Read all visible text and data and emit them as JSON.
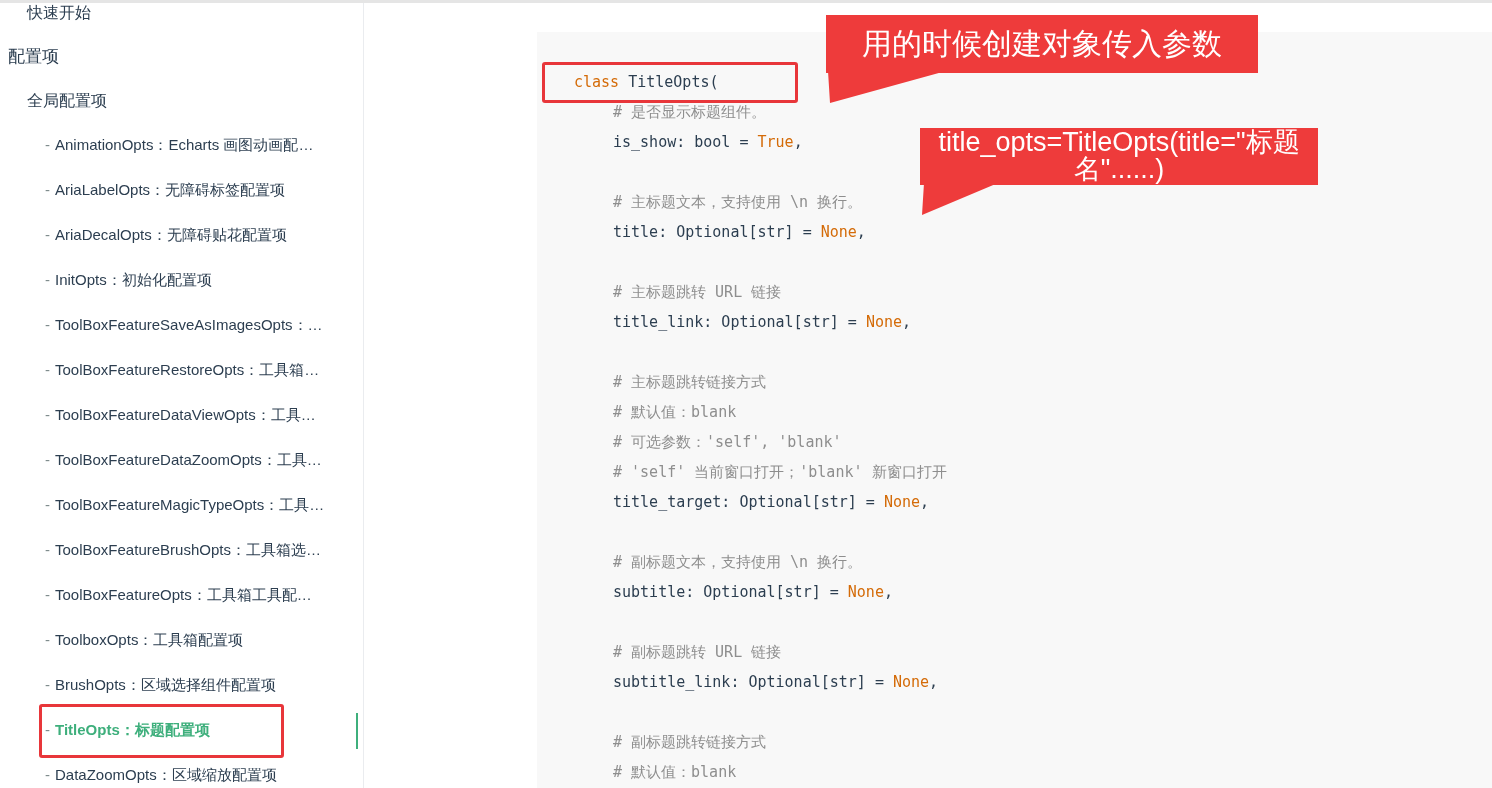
{
  "sidebar": {
    "items": [
      {
        "label": "快速开始",
        "kind": "page"
      },
      {
        "label": "配置项",
        "kind": "section",
        "children": [
          {
            "label": "全局配置项",
            "kind": "page",
            "children": [
              {
                "prefix": "-",
                "label": "AnimationOpts：Echarts 画图动画配…",
                "kind": "entry",
                "selected": false
              },
              {
                "prefix": "-",
                "label": "AriaLabelOpts：无障碍标签配置项",
                "kind": "entry",
                "selected": false
              },
              {
                "prefix": "-",
                "label": "AriaDecalOpts：无障碍贴花配置项",
                "kind": "entry",
                "selected": false
              },
              {
                "prefix": "-",
                "label": "InitOpts：初始化配置项",
                "kind": "entry",
                "selected": false
              },
              {
                "prefix": "-",
                "label": "ToolBoxFeatureSaveAsImagesOpts：…",
                "kind": "entry",
                "selected": false
              },
              {
                "prefix": "-",
                "label": "ToolBoxFeatureRestoreOpts：工具箱…",
                "kind": "entry",
                "selected": false
              },
              {
                "prefix": "-",
                "label": "ToolBoxFeatureDataViewOpts：工具…",
                "kind": "entry",
                "selected": false
              },
              {
                "prefix": "-",
                "label": "ToolBoxFeatureDataZoomOpts：工具…",
                "kind": "entry",
                "selected": false
              },
              {
                "prefix": "-",
                "label": "ToolBoxFeatureMagicTypeOpts：工具…",
                "kind": "entry",
                "selected": false
              },
              {
                "prefix": "-",
                "label": "ToolBoxFeatureBrushOpts：工具箱选…",
                "kind": "entry",
                "selected": false
              },
              {
                "prefix": "-",
                "label": "ToolBoxFeatureOpts：工具箱工具配…",
                "kind": "entry",
                "selected": false
              },
              {
                "prefix": "-",
                "label": "ToolboxOpts：工具箱配置项",
                "kind": "entry",
                "selected": false
              },
              {
                "prefix": "-",
                "label": "BrushOpts：区域选择组件配置项",
                "kind": "entry",
                "selected": false
              },
              {
                "prefix": "-",
                "label": "TitleOpts：标题配置项",
                "kind": "entry",
                "selected": true
              },
              {
                "prefix": "-",
                "label": "DataZoomOpts：区域缩放配置项",
                "kind": "entry",
                "selected": false
              }
            ]
          }
        ]
      }
    ]
  },
  "code": {
    "lines": [
      {
        "segments": [
          {
            "kind": "keyword",
            "text": "class"
          },
          {
            "kind": "plain",
            "text": " TitleOpts("
          }
        ],
        "children": [
          {
            "segments": [
              {
                "kind": "comment",
                "text": "# 是否显示标题组件。"
              }
            ]
          },
          {
            "segments": [
              {
                "kind": "plain",
                "text": "is_show: bool = "
              },
              {
                "kind": "value",
                "text": "True"
              },
              {
                "kind": "plain",
                "text": ","
              }
            ]
          },
          {
            "blank_before": true,
            "segments": [
              {
                "kind": "comment",
                "text": "# 主标题文本，支持使用 \\n 换行。"
              }
            ]
          },
          {
            "segments": [
              {
                "kind": "plain",
                "text": "title: Optional[str] = "
              },
              {
                "kind": "value",
                "text": "None"
              },
              {
                "kind": "plain",
                "text": ","
              }
            ]
          },
          {
            "blank_before": true,
            "segments": [
              {
                "kind": "comment",
                "text": "# 主标题跳转 URL 链接"
              }
            ]
          },
          {
            "segments": [
              {
                "kind": "plain",
                "text": "title_link: Optional[str] = "
              },
              {
                "kind": "value",
                "text": "None"
              },
              {
                "kind": "plain",
                "text": ","
              }
            ]
          },
          {
            "blank_before": true,
            "segments": [
              {
                "kind": "comment",
                "text": "# 主标题跳转链接方式"
              }
            ]
          },
          {
            "segments": [
              {
                "kind": "comment",
                "text": "# 默认值：blank"
              }
            ]
          },
          {
            "segments": [
              {
                "kind": "comment",
                "text": "# 可选参数：'self', 'blank'"
              }
            ]
          },
          {
            "segments": [
              {
                "kind": "comment",
                "text": "# 'self' 当前窗口打开；'blank' 新窗口打开"
              }
            ]
          },
          {
            "segments": [
              {
                "kind": "plain",
                "text": "title_target: Optional[str] = "
              },
              {
                "kind": "value",
                "text": "None"
              },
              {
                "kind": "plain",
                "text": ","
              }
            ]
          },
          {
            "blank_before": true,
            "segments": [
              {
                "kind": "comment",
                "text": "# 副标题文本，支持使用 \\n 换行。"
              }
            ]
          },
          {
            "segments": [
              {
                "kind": "plain",
                "text": "subtitle: Optional[str] = "
              },
              {
                "kind": "value",
                "text": "None"
              },
              {
                "kind": "plain",
                "text": ","
              }
            ]
          },
          {
            "blank_before": true,
            "segments": [
              {
                "kind": "comment",
                "text": "# 副标题跳转 URL 链接"
              }
            ]
          },
          {
            "segments": [
              {
                "kind": "plain",
                "text": "subtitle_link: Optional[str] = "
              },
              {
                "kind": "value",
                "text": "None"
              },
              {
                "kind": "plain",
                "text": ","
              }
            ]
          },
          {
            "blank_before": true,
            "segments": [
              {
                "kind": "comment",
                "text": "# 副标题跳转链接方式"
              }
            ]
          },
          {
            "segments": [
              {
                "kind": "comment",
                "text": "# 默认值：blank"
              }
            ]
          }
        ]
      }
    ]
  },
  "annotations": [
    {
      "kind": "callout",
      "text": "用的时候创建对象传入参数"
    },
    {
      "kind": "callout",
      "text": "title_opts=TitleOpts(title=\"标题名\"......)"
    }
  ]
}
